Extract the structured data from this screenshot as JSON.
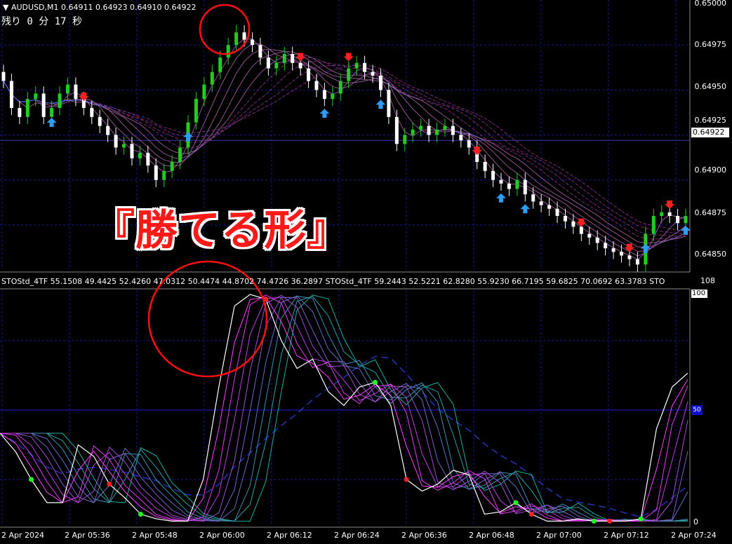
{
  "symbol_header": "AUDUSD,M1  0.64911 0.64923 0.64910 0.64922",
  "countdown": "残り 0 分 17 秒",
  "overlay_text": "『勝てる形』",
  "current_price": "0.64922",
  "price_labels": [
    "0.65000",
    "0.64975",
    "0.64950",
    "0.64925",
    "0.64900",
    "0.64875",
    "0.64850"
  ],
  "indicator_header": "STOStd_4TF 55.1508 49.4425 52.4260 47.0312 50.4474 44.8702 74.4726 36.2897  STOStd_4TF 59.2443 52.5221 62.8280 55.9230 66.7195 59.6825 70.0692 63.3783  STO",
  "indicator_scale": {
    "top": "108",
    "hundred": "100",
    "bottom": "0"
  },
  "level_badge": "50",
  "time_labels": [
    "2 Apr 2024",
    "2 Apr 05:36",
    "2 Apr 05:48",
    "2 Apr 06:00",
    "2 Apr 06:12",
    "2 Apr 06:24",
    "2 Apr 06:36",
    "2 Apr 06:48",
    "2 Apr 07:00",
    "2 Apr 07:12",
    "2 Apr 07:24"
  ],
  "colors": {
    "bull": "#22cc22",
    "bear": "#ffffff",
    "down_arrow": "#ff2020",
    "up_arrow": "#2a9dff",
    "grid": "#1a1a8c",
    "highlight_circle": "#ff1010"
  },
  "chart_data": {
    "type": "line",
    "symbol": "AUDUSD",
    "timeframe": "M1",
    "price_axis": [
      0.6485,
      0.65
    ],
    "closes": [
      0.64955,
      0.6494,
      0.64935,
      0.64945,
      0.64948,
      0.64935,
      0.6494,
      0.64948,
      0.64953,
      0.64945,
      0.6494,
      0.64935,
      0.6493,
      0.64925,
      0.64918,
      0.6492,
      0.64912,
      0.64915,
      0.64908,
      0.649,
      0.64905,
      0.6491,
      0.64918,
      0.64932,
      0.64945,
      0.64953,
      0.6496,
      0.64968,
      0.64975,
      0.64982,
      0.64978,
      0.64975,
      0.64968,
      0.64962,
      0.64965,
      0.6497,
      0.64965,
      0.64962,
      0.64955,
      0.6495,
      0.64945,
      0.64948,
      0.64955,
      0.64962,
      0.64965,
      0.6496,
      0.64958,
      0.6495,
      0.64935,
      0.6492,
      0.64925,
      0.64928,
      0.6493,
      0.64925,
      0.64928,
      0.6493,
      0.64925,
      0.64922,
      0.64918,
      0.6491,
      0.64905,
      0.649,
      0.64898,
      0.64895,
      0.649,
      0.64892,
      0.64888,
      0.64886,
      0.64884,
      0.6488,
      0.64877,
      0.64874,
      0.6487,
      0.64868,
      0.64865,
      0.64862,
      0.6486,
      0.64858,
      0.64856,
      0.64853,
      0.6487,
      0.6488,
      0.64882,
      0.6488,
      0.64876,
      0.6488
    ],
    "stochastic_fast": [
      40,
      32,
      20,
      10,
      10,
      35,
      30,
      18,
      12,
      5,
      3,
      2,
      2,
      20,
      60,
      95,
      100,
      98,
      80,
      68,
      72,
      58,
      52,
      60,
      62,
      52,
      20,
      15,
      18,
      24,
      22,
      5,
      6,
      10,
      5,
      2,
      2,
      3,
      2,
      2,
      2,
      3,
      42,
      60,
      66
    ],
    "stochastic_range": [
      0,
      100
    ],
    "level_line": 50
  }
}
